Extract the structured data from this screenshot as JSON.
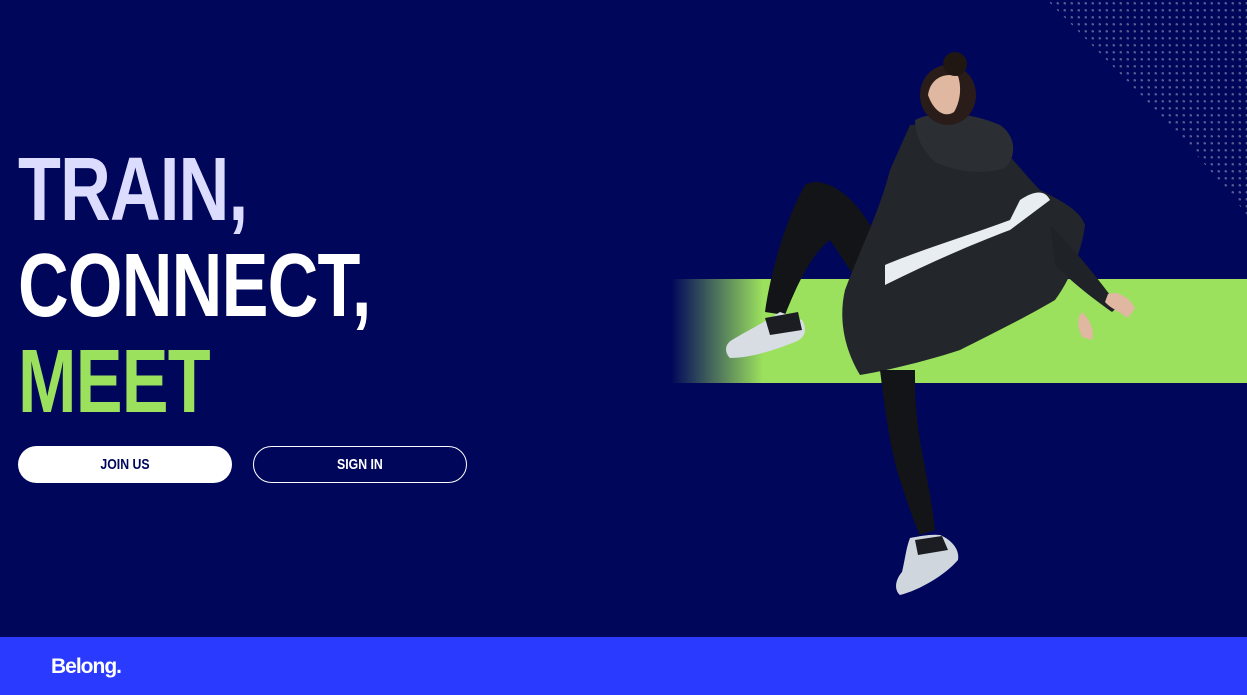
{
  "hero": {
    "lines": [
      "TRAIN,",
      "CONNECT,",
      "MEET"
    ],
    "line_colors": [
      "#dcdcff",
      "#ffffff",
      "#9be15d"
    ]
  },
  "buttons": {
    "join_label": "JOIN US",
    "signin_label": "SIGN IN"
  },
  "footer": {
    "logo_text": "Belong."
  },
  "colors": {
    "background": "#00065a",
    "accent_green": "#9be15d",
    "footer_blue": "#2a3bff",
    "white": "#ffffff"
  },
  "icons": {
    "decor": "halftone-dots",
    "image": "athlete-photo"
  }
}
